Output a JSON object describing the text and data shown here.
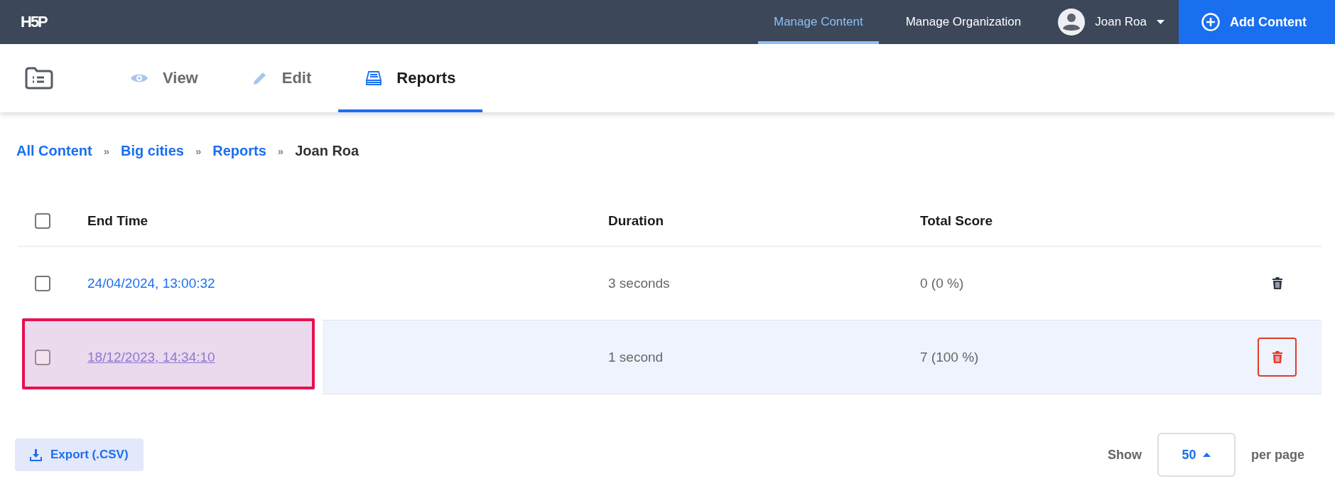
{
  "logo": "H5P",
  "nav": [
    {
      "label": "Manage Content",
      "selected": true
    },
    {
      "label": "Manage Organization",
      "selected": false
    }
  ],
  "user": {
    "name": "Joan Roa"
  },
  "add_button": "Add Content",
  "tabs": [
    {
      "label": "View",
      "kind": "eye",
      "selected": false
    },
    {
      "label": "Edit",
      "kind": "pencil",
      "selected": false
    },
    {
      "label": "Reports",
      "kind": "report",
      "selected": true
    }
  ],
  "breadcrumbs": [
    {
      "label": "All Content",
      "link": true
    },
    {
      "label": "Big cities",
      "link": true
    },
    {
      "label": "Reports",
      "link": true
    },
    {
      "label": "Joan Roa",
      "link": false
    }
  ],
  "breadcrumb_separator": "»",
  "table": {
    "select_all": {
      "checked": false
    },
    "columns": [
      "End Time",
      "Duration",
      "Total Score"
    ],
    "rows": [
      {
        "checked": false,
        "end_time": "24/04/2024, 13:00:32",
        "duration": "3 seconds",
        "total_score": "0 (0 %)",
        "hovered": false,
        "highlighted": false
      },
      {
        "checked": false,
        "end_time": "18/12/2023, 14:34:10",
        "duration": "1 second",
        "total_score": "7 (100 %)",
        "hovered": true,
        "highlighted": true
      }
    ]
  },
  "export_button": "Export (.CSV)",
  "pagination": {
    "show_label": "Show",
    "per_page_value": "50",
    "per_page_label": "per page"
  }
}
